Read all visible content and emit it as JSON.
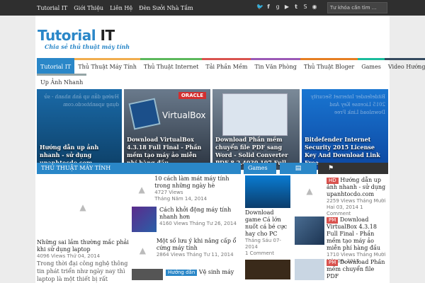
{
  "topbar": {
    "nav": [
      "Tutorial IT",
      "Giới Thiệu",
      "Liên Hệ",
      "Đèn Sưởi Nhà Tắm"
    ],
    "social_icons": [
      "twitter-icon",
      "facebook-icon",
      "google-plus-icon",
      "youtube-icon",
      "tumblr-icon",
      "skype-icon",
      "rss-icon"
    ],
    "search_placeholder": "Tư khóa cần tìm ..."
  },
  "logo": {
    "part1": "Tutorial",
    "part2": "IT",
    "tagline": "Chia sẻ thủ thuật máy tính"
  },
  "mainnav": {
    "row1": [
      "Tutorial IT",
      "Thủ Thuật Máy Tính",
      "Thủ Thuật Internet",
      "Tải Phần Mềm",
      "Tin Văn Phòng",
      "Thủ Thuật Bloger",
      "Games",
      "Video Hướng Dẫn"
    ],
    "row2": [
      "Up Ảnh Nhanh"
    ],
    "colors": [
      "#2a87c8",
      "#f0ad4e",
      "#5cb85c",
      "#d9534f",
      "#9b59b6",
      "#e67e22",
      "#1abc9c",
      "#34495e",
      "#95a5a6"
    ]
  },
  "slides": [
    {
      "caption": "Hướng dẫn up ảnh nhanh - sử dụng upanhtocdo.com",
      "blur": "Hướng dẫn up ảnh nhanh - sử dụng upanhtocdo.com"
    },
    {
      "caption": "Download VirtualBox 4.3.18 Full Final - Phần mềm tạo máy ảo miễn phí hàng đầu",
      "logo": "VirtualBox",
      "brand": "ORACLE"
    },
    {
      "caption": "Download Phần mềm chuyển file PDF sang Word - Solid Converter PDF 8.2.4030.107 Full",
      "blur": "Download Phần mềm chuyển file PDF sang Word"
    },
    {
      "caption": "Bitdefender Internet Security 2015 License Key And Download Link Free",
      "blur": "Bitdefender Internet Security 2015 License Key And Download Link Free"
    }
  ],
  "left_section": {
    "header": "THỦ THUẬT MÁY TÍNH",
    "featured": {
      "title": "Những sai lầm thường mắc phải khi sử dụng laptop",
      "views": "4096 Views",
      "date": "Thứ 04, 2014",
      "excerpt": "Trong thời đại công nghệ thông tin phát triển như ngày nay thì laptop là một thiết bị rất"
    },
    "items": [
      {
        "title": "10 cách làm mát máy tính trong những ngày hè",
        "views": "4727 Views",
        "date": "Tháng Năm 14, 2014"
      },
      {
        "title": "Cách khởi động máy tính nhanh hơn",
        "views": "4160 Views",
        "date": "Tháng Tư 26, 2014"
      },
      {
        "title": "Một số lưu ý khi nâng cấp ổ cứng máy tính",
        "views": "2864 Views",
        "date": "Tháng Tư 11, 2014"
      },
      {
        "title": "Vệ sinh máy",
        "badge": "Hướng dẫn"
      }
    ]
  },
  "games_section": {
    "header": "Games",
    "item": {
      "title": "Download game Cá lớn nuốt cá bé cực hay cho PC",
      "date": "Tháng Sáu 07-2014",
      "comments": "1 Comment"
    }
  },
  "right_section": {
    "tabs": [
      "file-icon",
      "tags-icon"
    ],
    "items": [
      {
        "badge": "HD",
        "title": "Hướng dẫn up ảnh nhanh - sử dụng upanhtocdo.com",
        "views": "2259 Views",
        "date": "Tháng Mười Hai 03, 2014",
        "comments": "1 Comment"
      },
      {
        "badge": "PM",
        "title": "Download VirtualBox 4.3.18 Full Final - Phần mềm tạo máy ảo miễn phí hàng đầu",
        "views": "1710 Views",
        "date": "Tháng Mười Một 08, 2014"
      },
      {
        "badge": "PM",
        "title": "Download Phần mềm chuyển file PDF"
      }
    ]
  }
}
